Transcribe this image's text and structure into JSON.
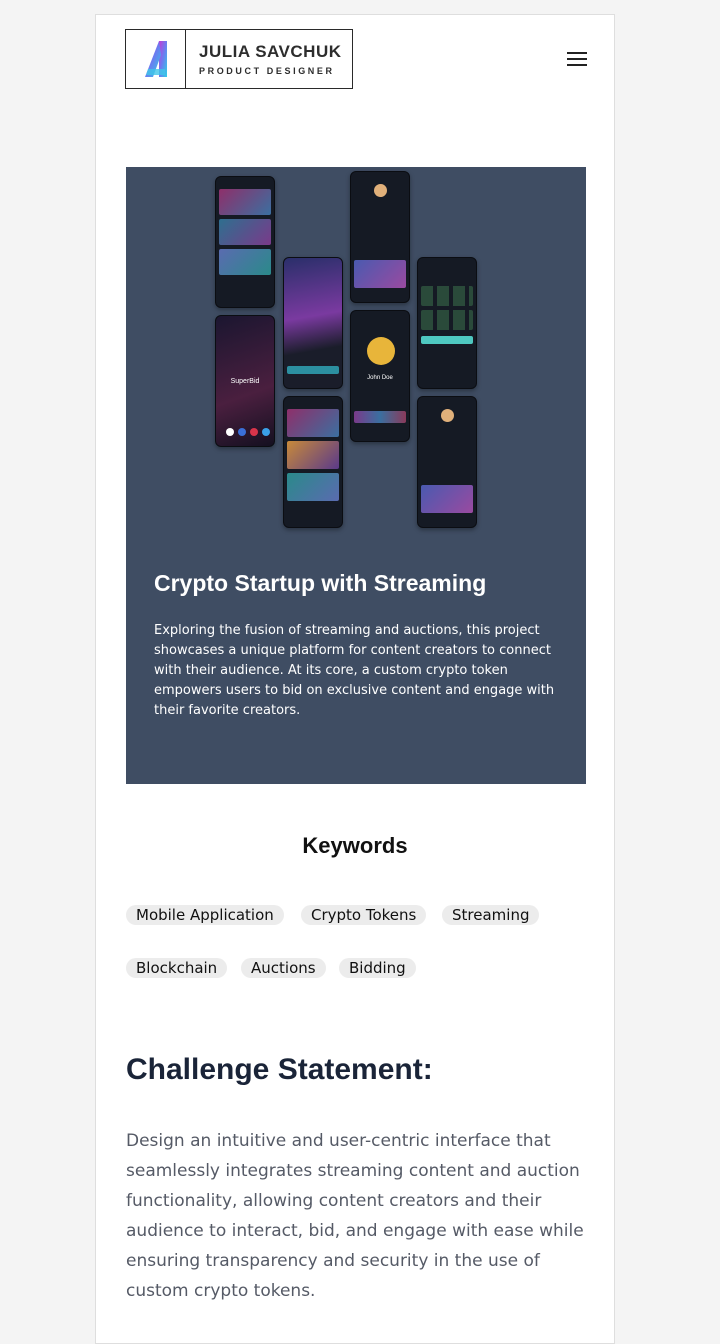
{
  "header": {
    "logo_name": "JULIA SAVCHUK",
    "logo_role": "PRODUCT DESIGNER",
    "menu_icon": "hamburger-menu-icon"
  },
  "hero": {
    "background": "#3f4d63",
    "title": "Crypto Startup with Streaming",
    "description": "Exploring the fusion of streaming and auctions, this project showcases a unique platform for content creators to connect with their audience. At its core, a custom crypto token empowers users to bid on exclusive content and engage with their favorite creators.",
    "mockup_labels": {
      "app_name": "SuperBid",
      "profile_name": "John Doe"
    }
  },
  "keywords": {
    "title": "Keywords",
    "items": [
      "Mobile Application",
      "Crypto Tokens",
      "Streaming",
      "Blockchain",
      "Auctions",
      "Bidding"
    ]
  },
  "challenge": {
    "title": "Challenge Statement:",
    "body": "Design an intuitive and user-centric interface that seamlessly integrates streaming content and auction functionality, allowing content creators and their audience to interact, bid, and engage with ease while ensuring transparency and security in the use of custom crypto tokens."
  }
}
